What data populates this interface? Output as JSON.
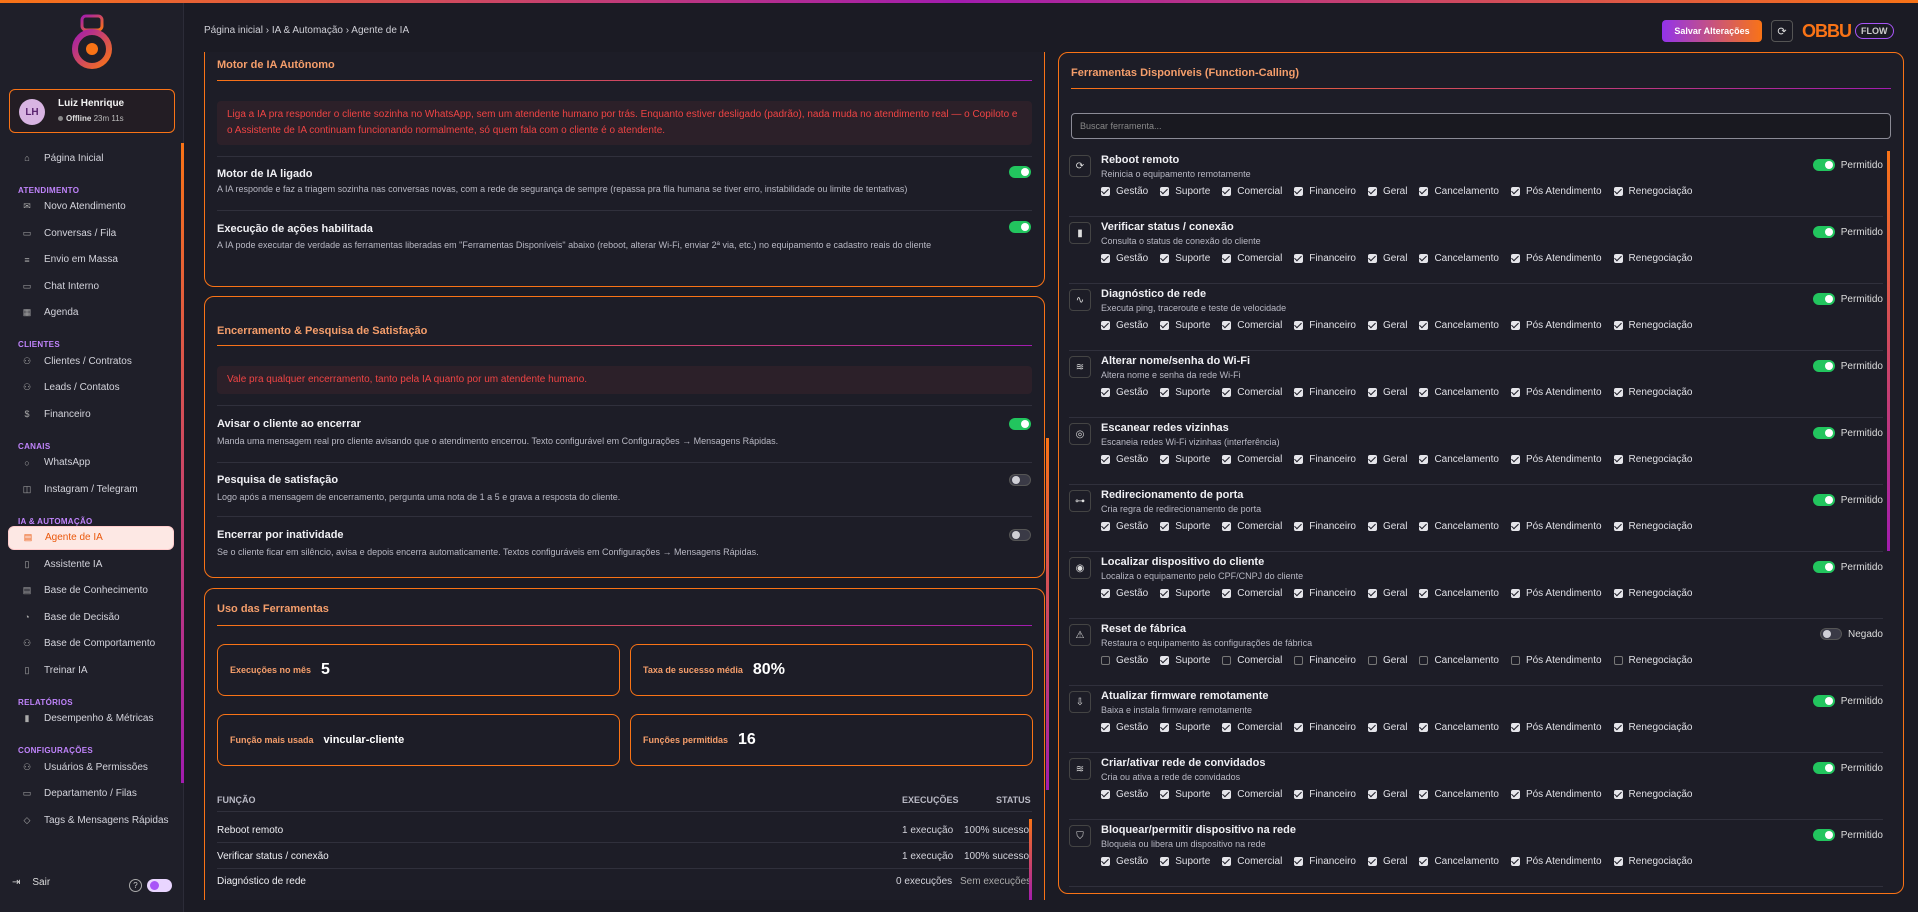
{
  "user": {
    "initials": "LH",
    "name": "Luiz Henrique",
    "status": "Offline",
    "time": "23m 11s"
  },
  "sidebar": {
    "top": [
      {
        "label": "Página Inicial",
        "icon": "home-icon",
        "glyph": "⌂"
      }
    ],
    "sections": [
      {
        "title": "ATENDIMENTO",
        "items": [
          {
            "label": "Novo Atendimento",
            "glyph": "✉"
          },
          {
            "label": "Conversas / Fila",
            "glyph": "▭"
          },
          {
            "label": "Envio em Massa",
            "glyph": "≡"
          },
          {
            "label": "Chat Interno",
            "glyph": "▭"
          },
          {
            "label": "Agenda",
            "glyph": "▦"
          }
        ]
      },
      {
        "title": "CLIENTES",
        "items": [
          {
            "label": "Clientes / Contratos",
            "glyph": "⚇"
          },
          {
            "label": "Leads / Contatos",
            "glyph": "⚇"
          },
          {
            "label": "Financeiro",
            "glyph": "$"
          }
        ]
      },
      {
        "title": "CANAIS",
        "items": [
          {
            "label": "WhatsApp",
            "glyph": "○"
          },
          {
            "label": "Instagram / Telegram",
            "glyph": "◫"
          }
        ]
      },
      {
        "title": "IA & AUTOMAÇÃO",
        "items": [
          {
            "label": "Agente de IA",
            "glyph": "▤",
            "active": true
          },
          {
            "label": "Assistente IA",
            "glyph": "▯"
          },
          {
            "label": "Base de Conhecimento",
            "glyph": "▤"
          },
          {
            "label": "Base de Decisão",
            "glyph": "◔"
          },
          {
            "label": "Base de Comportamento",
            "glyph": "⚇"
          },
          {
            "label": "Treinar IA",
            "glyph": "▯"
          }
        ]
      },
      {
        "title": "RELATÓRIOS",
        "items": [
          {
            "label": "Desempenho & Métricas",
            "glyph": "▮"
          }
        ]
      },
      {
        "title": "CONFIGURAÇÕES",
        "items": [
          {
            "label": "Usuários & Permissões",
            "glyph": "⚇"
          },
          {
            "label": "Departamento / Filas",
            "glyph": "▭"
          },
          {
            "label": "Tags & Mensagens Rápidas",
            "glyph": "◇"
          }
        ]
      }
    ],
    "logout": "Sair",
    "help": "?"
  },
  "header": {
    "breadcrumb": "Página inicial › IA & Automação › Agente de IA",
    "save_label": "Salvar Alterações",
    "refresh_glyph": "⟳",
    "brand": "OBBU",
    "brand_tag": "FLOW"
  },
  "motor": {
    "title": "Motor de IA Autônomo",
    "notice": "Liga a IA pra responder o cliente sozinha no WhatsApp, sem um atendente humano por trás. Enquanto estiver desligado (padrão), nada muda no atendimento real — o Copiloto e o Assistente de IA continuam funcionando normalmente, só quem fala com o cliente é o atendente.",
    "rows": [
      {
        "title": "Motor de IA ligado",
        "desc": "A IA responde e faz a triagem sozinha nas conversas novas, com a rede de segurança de sempre (repassa pra fila humana se tiver erro, instabilidade ou limite de tentativas)",
        "on": true
      },
      {
        "title": "Execução de ações habilitada",
        "desc": "A IA pode executar de verdade as ferramentas liberadas em \"Ferramentas Disponíveis\" abaixo (reboot, alterar Wi-Fi, enviar 2ª via, etc.) no equipamento e cadastro reais do cliente",
        "on": true
      }
    ]
  },
  "closing": {
    "title": "Encerramento & Pesquisa de Satisfação",
    "notice": "Vale pra qualquer encerramento, tanto pela IA quanto por um atendente humano.",
    "rows": [
      {
        "title": "Avisar o cliente ao encerrar",
        "desc": "Manda uma mensagem real pro cliente avisando que o atendimento encerrou. Texto configurável em Configurações → Mensagens Rápidas.",
        "on": true
      },
      {
        "title": "Pesquisa de satisfação",
        "desc": "Logo após a mensagem de encerramento, pergunta uma nota de 1 a 5 e grava a resposta do cliente.",
        "on": false
      },
      {
        "title": "Encerrar por inatividade",
        "desc": "Se o cliente ficar em silêncio, avisa e depois encerra automaticamente. Textos configuráveis em Configurações → Mensagens Rápidas.",
        "on": false
      }
    ]
  },
  "usage": {
    "title": "Uso das Ferramentas",
    "stats": [
      {
        "label": "Execuções no mês",
        "value": "5"
      },
      {
        "label": "Taxa de sucesso média",
        "value": "80%"
      },
      {
        "label": "Função mais usada",
        "value": "vincular-cliente"
      },
      {
        "label": "Funções permitidas",
        "value": "16"
      }
    ],
    "columns": [
      "FUNÇÃO",
      "EXECUÇÕES",
      "STATUS"
    ],
    "rows": [
      {
        "name": "Reboot remoto",
        "exec": "1 execução",
        "status": "100% sucesso"
      },
      {
        "name": "Verificar status / conexão",
        "exec": "1 execução",
        "status": "100% sucesso"
      },
      {
        "name": "Diagnóstico de rede",
        "exec": "0 execuções",
        "status": "Sem execuções"
      }
    ]
  },
  "tools": {
    "title": "Ferramentas Disponíveis (Function-Calling)",
    "search_placeholder": "Buscar ferramenta...",
    "departments": [
      "Gestão",
      "Suporte",
      "Comercial",
      "Financeiro",
      "Geral",
      "Cancelamento",
      "Pós Atendimento",
      "Renegociação"
    ],
    "allowed_label": "Permitido",
    "denied_label": "Negado",
    "items": [
      {
        "name": "Reboot remoto",
        "desc": "Reinicia o equipamento remotamente",
        "glyph": "⟳",
        "allowed": true,
        "checks": [
          1,
          1,
          1,
          1,
          1,
          1,
          1,
          1
        ]
      },
      {
        "name": "Verificar status / conexão",
        "desc": "Consulta o status de conexão do cliente",
        "glyph": "▮",
        "allowed": true,
        "checks": [
          1,
          1,
          1,
          1,
          1,
          1,
          1,
          1
        ]
      },
      {
        "name": "Diagnóstico de rede",
        "desc": "Executa ping, traceroute e teste de velocidade",
        "glyph": "∿",
        "allowed": true,
        "checks": [
          1,
          1,
          1,
          1,
          1,
          1,
          1,
          1
        ]
      },
      {
        "name": "Alterar nome/senha do Wi-Fi",
        "desc": "Altera nome e senha da rede Wi-Fi",
        "glyph": "≋",
        "allowed": true,
        "checks": [
          1,
          1,
          1,
          1,
          1,
          1,
          1,
          1
        ]
      },
      {
        "name": "Escanear redes vizinhas",
        "desc": "Escaneia redes Wi-Fi vizinhas (interferência)",
        "glyph": "◎",
        "allowed": true,
        "checks": [
          1,
          1,
          1,
          1,
          1,
          1,
          1,
          1
        ]
      },
      {
        "name": "Redirecionamento de porta",
        "desc": "Cria regra de redirecionamento de porta",
        "glyph": "⊶",
        "allowed": true,
        "checks": [
          1,
          1,
          1,
          1,
          1,
          1,
          1,
          1
        ]
      },
      {
        "name": "Localizar dispositivo do cliente",
        "desc": "Localiza o equipamento pelo CPF/CNPJ do cliente",
        "glyph": "◉",
        "allowed": true,
        "checks": [
          1,
          1,
          1,
          1,
          1,
          1,
          1,
          1
        ]
      },
      {
        "name": "Reset de fábrica",
        "desc": "Restaura o equipamento às configurações de fábrica",
        "glyph": "⚠",
        "allowed": false,
        "checks": [
          0,
          1,
          0,
          0,
          0,
          0,
          0,
          0
        ]
      },
      {
        "name": "Atualizar firmware remotamente",
        "desc": "Baixa e instala firmware remotamente",
        "glyph": "⇩",
        "allowed": true,
        "checks": [
          1,
          1,
          1,
          1,
          1,
          1,
          1,
          1
        ]
      },
      {
        "name": "Criar/ativar rede de convidados",
        "desc": "Cria ou ativa a rede de convidados",
        "glyph": "≋",
        "allowed": true,
        "checks": [
          1,
          1,
          1,
          1,
          1,
          1,
          1,
          1
        ]
      },
      {
        "name": "Bloquear/permitir dispositivo na rede",
        "desc": "Bloqueia ou libera um dispositivo na rede",
        "glyph": "⛉",
        "allowed": true,
        "checks": [
          1,
          1,
          1,
          1,
          1,
          1,
          1,
          1
        ]
      }
    ]
  }
}
